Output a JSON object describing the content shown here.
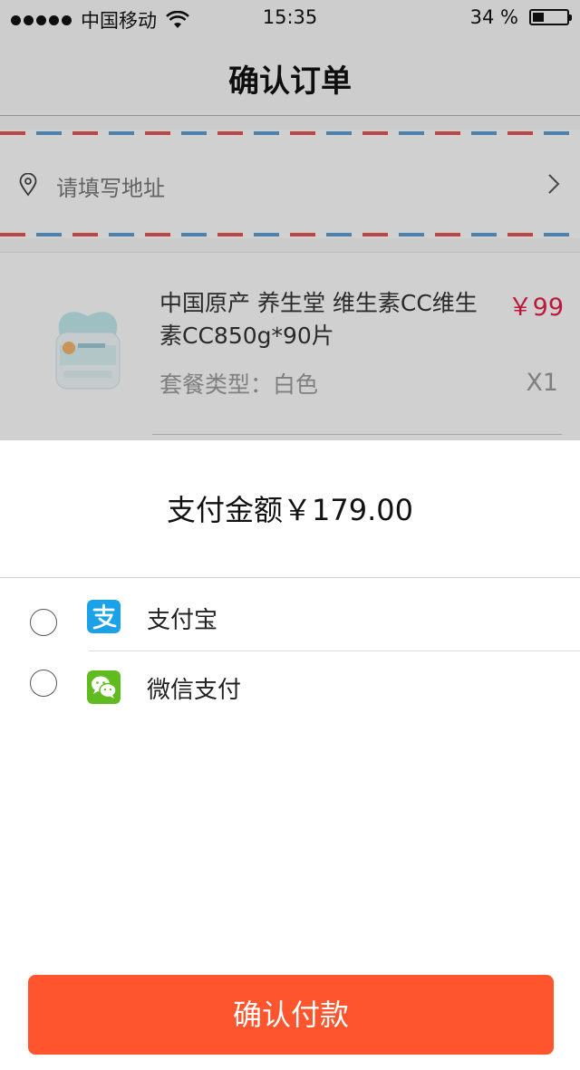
{
  "status_bar": {
    "carrier": "中国移动",
    "time": "15:35",
    "battery_percent": "34 %",
    "battery_level": 0.34
  },
  "navbar": {
    "title": "确认订单"
  },
  "address": {
    "placeholder": "请填写地址"
  },
  "product": {
    "title": "中国原产 养生堂 维生素CC维生素CC850g*90片",
    "price": "￥99",
    "spec": "套餐类型：白色",
    "quantity": "X1"
  },
  "payment": {
    "amount_label": "支付金额",
    "amount_value": "￥179.00",
    "methods": [
      {
        "label": "支付宝",
        "icon": "alipay-icon",
        "color": "#1aa1e8"
      },
      {
        "label": "微信支付",
        "icon": "wechat-pay-icon",
        "color": "#5fbb1f"
      }
    ],
    "confirm_label": "确认付款"
  },
  "colors": {
    "accent": "#ff552e",
    "price": "#e31d43"
  }
}
